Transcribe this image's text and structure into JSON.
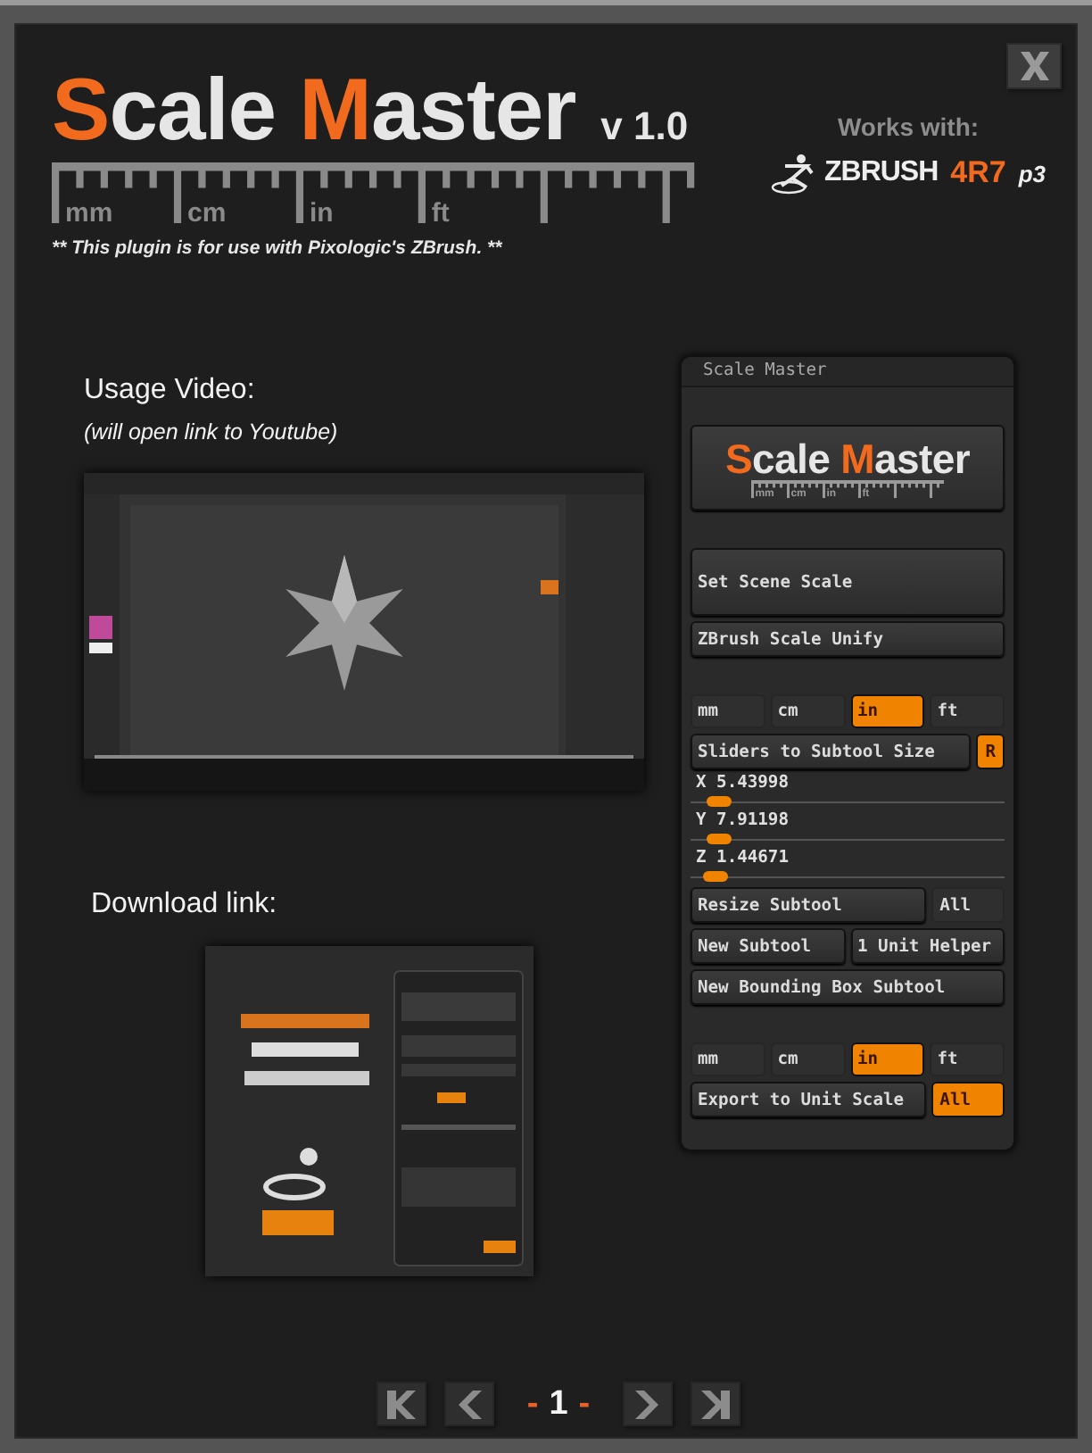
{
  "header": {
    "title": [
      {
        "text": "S",
        "accent": true
      },
      {
        "text": "cale ",
        "accent": false
      },
      {
        "text": "M",
        "accent": true
      },
      {
        "text": "aster",
        "accent": false
      }
    ],
    "version": "v 1.0",
    "ruler_labels": [
      "mm",
      "cm",
      "in",
      "ft"
    ],
    "note": "** This plugin is for use with Pixologic's ZBrush. **"
  },
  "works_with": {
    "label": "Works with:",
    "product": "ZBRUSH",
    "version": "4R7",
    "patch": "p3"
  },
  "video": {
    "heading": "Usage Video:",
    "subheading": "(will open link to Youtube)",
    "kind": "picture"
  },
  "download": {
    "heading": "Download link:",
    "kind": "picture"
  },
  "plugin_panel": {
    "title": "Scale Master",
    "sections": [
      [
        {
          "kind": "logo",
          "title": [
            {
              "text": "S",
              "accent": true
            },
            {
              "text": "cale ",
              "accent": false
            },
            {
              "text": "M",
              "accent": true
            },
            {
              "text": "aster",
              "accent": false
            }
          ],
          "ruler_labels": [
            "mm",
            "cm",
            "in",
            "ft"
          ]
        }
      ],
      [
        {
          "kind": "big_button",
          "label": "Set Scene Scale"
        },
        {
          "kind": "button",
          "label": "ZBrush Scale Unify"
        }
      ],
      [
        {
          "kind": "units",
          "options": [
            {
              "label": "mm",
              "selected": false
            },
            {
              "label": "cm",
              "selected": false
            },
            {
              "label": "in",
              "selected": true
            },
            {
              "label": "ft",
              "selected": false
            }
          ]
        },
        {
          "kind": "button_toggle",
          "label": "Sliders to Subtool Size",
          "toggle": {
            "label": "R",
            "on": true
          }
        },
        {
          "kind": "slider",
          "label": "X 5.43998",
          "level": 0.05
        },
        {
          "kind": "slider",
          "label": "Y 7.91198",
          "level": 0.05
        },
        {
          "kind": "slider",
          "label": "Z 1.44671",
          "level": 0.04
        },
        {
          "kind": "button_toggle",
          "label": "Resize Subtool",
          "toggle": {
            "label": "All",
            "on": false
          }
        },
        {
          "kind": "button_pair",
          "buttons": [
            "New Subtool",
            "1 Unit Helper"
          ]
        },
        {
          "kind": "button",
          "label": "New Bounding Box Subtool"
        }
      ],
      [
        {
          "kind": "units",
          "options": [
            {
              "label": "mm",
              "selected": false
            },
            {
              "label": "cm",
              "selected": false
            },
            {
              "label": "in",
              "selected": true
            },
            {
              "label": "ft",
              "selected": false
            }
          ]
        },
        {
          "kind": "button_toggle",
          "label": "Export to Unit Scale",
          "toggle": {
            "label": "All",
            "on": true
          }
        }
      ]
    ]
  },
  "pagination": {
    "left_dash": "-",
    "page": "1",
    "right_dash": "-"
  }
}
